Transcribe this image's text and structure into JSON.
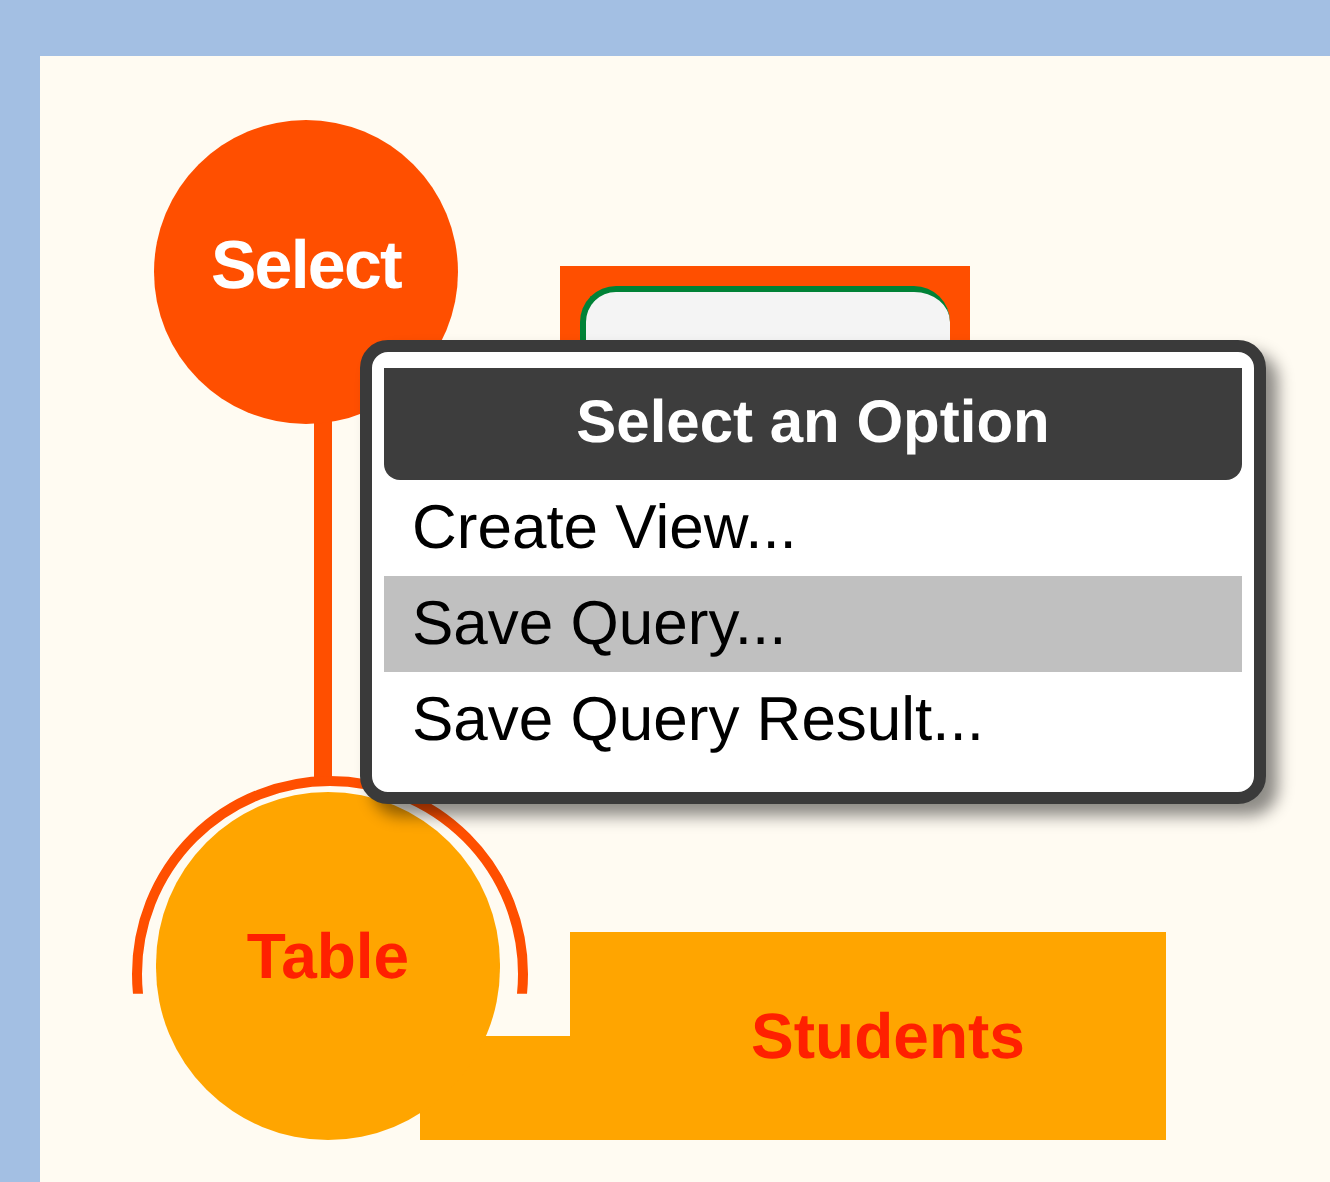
{
  "nodes": [
    {
      "kind": "select",
      "label": "Select"
    },
    {
      "kind": "table",
      "label": "Table",
      "value": "Students"
    }
  ],
  "menu": {
    "title": "Select an Option",
    "items": [
      {
        "label": "Create View...",
        "selected": false
      },
      {
        "label": "Save Query...",
        "selected": true
      },
      {
        "label": "Save Query Result...",
        "selected": false
      }
    ]
  }
}
